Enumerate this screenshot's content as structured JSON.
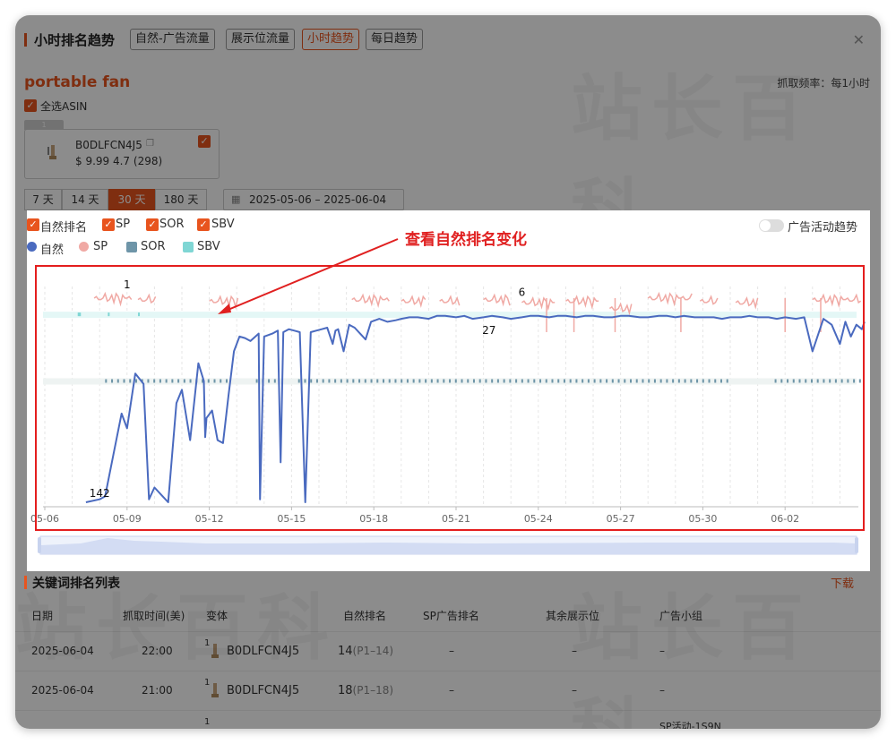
{
  "header": {
    "title": "小时排名趋势",
    "tabs": [
      "自然-广告流量",
      "展示位流量",
      "小时趋势",
      "每日趋势"
    ],
    "active_tab": "小时趋势"
  },
  "keyword": "portable fan",
  "frequency": "抓取频率：每1小时",
  "select_all": "全选ASIN",
  "asin_card": {
    "index": "1",
    "asin": "B0DLFCN4J5",
    "price_rating": "$ 9.99 4.7 (298)"
  },
  "ranges": [
    "7 天",
    "14 天",
    "30 天",
    "180 天"
  ],
  "active_range": "30 天",
  "date_range": "2025-05-06  –  2025-06-04",
  "filters": [
    "自然排名",
    "SP",
    "SOR",
    "SBV"
  ],
  "legend": [
    {
      "name": "自然",
      "color": "#4a6abf",
      "shape": "dot"
    },
    {
      "name": "SP",
      "color": "#f0a9a4",
      "shape": "dot"
    },
    {
      "name": "SOR",
      "color": "#6e95a8",
      "shape": "square"
    },
    {
      "name": "SBV",
      "color": "#7fd6d4",
      "shape": "square"
    }
  ],
  "ad_toggle_label": "广告活动趋势",
  "annotation": "查看自然排名变化",
  "chart_data": {
    "type": "line",
    "x_ticks": [
      "05-06",
      "05-09",
      "05-12",
      "05-15",
      "05-18",
      "05-21",
      "05-24",
      "05-27",
      "05-30",
      "06-02"
    ],
    "data_labels": [
      {
        "text": "1",
        "series": "SP"
      },
      {
        "text": "142",
        "series": "自然"
      },
      {
        "text": "6",
        "series": "自然"
      },
      {
        "text": "27",
        "series": "SP"
      }
    ],
    "y_reversed": true,
    "grid": "vertical-dashed",
    "series": [
      {
        "name": "自然",
        "color": "#4a6abf",
        "day": [
          1.5,
          2.0,
          2.2,
          2.5,
          2.8,
          3.0,
          3.3,
          3.6,
          3.8,
          4.0,
          4.3,
          4.5,
          4.8,
          5.0,
          5.3,
          5.6,
          5.8,
          5.85,
          5.9,
          6.1,
          6.3,
          6.5,
          6.7,
          6.9,
          7.1,
          7.3,
          7.5,
          7.8,
          7.85,
          8.0,
          8.3,
          8.5,
          8.6,
          8.7,
          8.9,
          9.1,
          9.3,
          9.5,
          9.7,
          9.9,
          10.1,
          10.3,
          10.5,
          10.6,
          10.7,
          10.9,
          11.1,
          11.3,
          11.5,
          11.7,
          11.9,
          12.2,
          12.5,
          12.8,
          13.0,
          13.3,
          13.6,
          14.0,
          14.3,
          14.6,
          15.0,
          15.3,
          15.6,
          16.0,
          16.3,
          16.7,
          17.0,
          17.4,
          17.7,
          18.0,
          18.4,
          18.7,
          19.0,
          19.4,
          19.7,
          20.0,
          20.4,
          20.7,
          21.0,
          21.3,
          21.7,
          22.0,
          22.4,
          22.7,
          23.0,
          23.3,
          23.7,
          24.0,
          24.4,
          24.7,
          25.0,
          25.4,
          25.7,
          26.0,
          26.4,
          26.7,
          27.0,
          27.4,
          27.7,
          28.0,
          28.4,
          28.7,
          29.0,
          29.2,
          29.4,
          29.6,
          29.8,
          29.9
        ],
        "rank": [
          142,
          140,
          138,
          110,
          82,
          92,
          55,
          62,
          140,
          132,
          138,
          142,
          75,
          66,
          100,
          48,
          60,
          98,
          85,
          80,
          100,
          102,
          70,
          40,
          30,
          31,
          33,
          28,
          140,
          30,
          28,
          26,
          115,
          27,
          25,
          26,
          27,
          142,
          27,
          26,
          25,
          24,
          35,
          26,
          25,
          40,
          22,
          24,
          28,
          32,
          20,
          18,
          20,
          19,
          18,
          17,
          17,
          18,
          16,
          16,
          17,
          16,
          18,
          17,
          16,
          17,
          18,
          17,
          16,
          16,
          17,
          16,
          16,
          17,
          16,
          16,
          17,
          17,
          16,
          16,
          17,
          17,
          16,
          16,
          17,
          16,
          17,
          17,
          17,
          18,
          17,
          17,
          16,
          17,
          17,
          18,
          17,
          18,
          17,
          40,
          18,
          22,
          35,
          20,
          30,
          22,
          25,
          20
        ]
      },
      {
        "name": "SP",
        "color": "#f0a9a4",
        "range": "1-27"
      },
      {
        "name": "SOR",
        "color": "#6e95a8"
      },
      {
        "name": "SBV",
        "color": "#7fd6d4"
      }
    ]
  },
  "table": {
    "title": "关键词排名列表",
    "download": "下载",
    "headers": [
      "日期",
      "抓取时间(美)",
      "变体",
      "自然排名",
      "SP广告排名",
      "其余展示位",
      "广告小组"
    ],
    "rows": [
      {
        "date": "2025-06-04",
        "time": "22:00",
        "idx": "1",
        "asin": "B0DLFCN4J5",
        "rank": "14",
        "page": "(P1–14)",
        "sp": "–",
        "other": "–",
        "group": "–"
      },
      {
        "date": "2025-06-04",
        "time": "21:00",
        "idx": "1",
        "asin": "B0DLFCN4J5",
        "rank": "18",
        "page": "(P1–18)",
        "sp": "–",
        "other": "–",
        "group": "–"
      },
      {
        "date": "",
        "time": "",
        "idx": "1",
        "asin": "",
        "rank": "",
        "page": "",
        "sp": "",
        "other": "",
        "group": "SP活动-1S9N"
      }
    ]
  },
  "colors": {
    "accent": "#e8541e",
    "annotation": "#e41e1e"
  }
}
